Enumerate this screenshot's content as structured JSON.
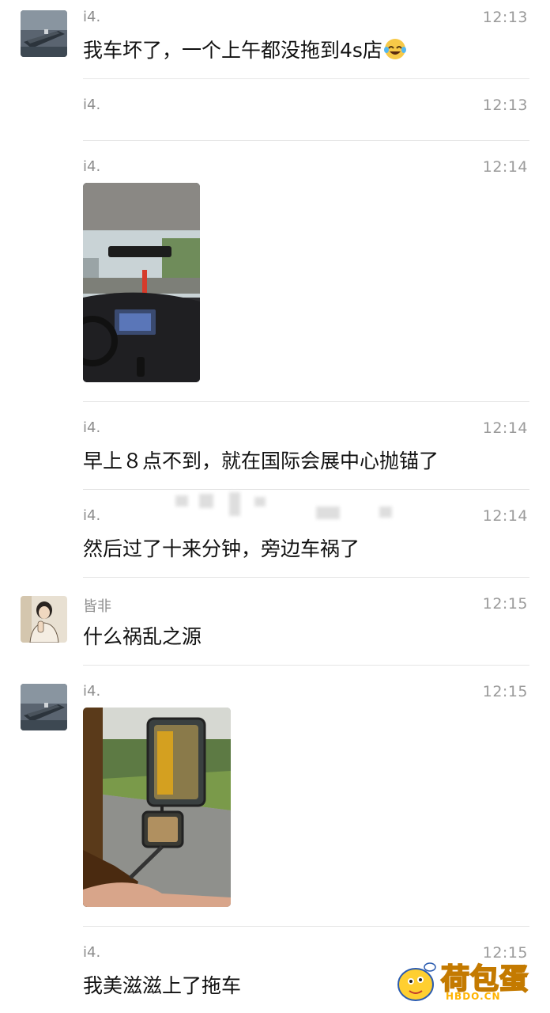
{
  "messages": [
    {
      "name": "i4.",
      "time": "12:13",
      "text": "我车坏了，一个上午都没拖到4s店"
    },
    {
      "name": "i4.",
      "time": "12:13",
      "text": ""
    },
    {
      "name": "i4.",
      "time": "12:14",
      "text": ""
    },
    {
      "name": "i4.",
      "time": "12:14",
      "text": "早上８点不到，就在国际会展中心抛锚了"
    },
    {
      "name": "i4.",
      "time": "12:14",
      "text": "然后过了十来分钟，旁边车祸了"
    },
    {
      "name": "皆非",
      "time": "12:15",
      "text": "什么祸乱之源"
    },
    {
      "name": "i4.",
      "time": "12:15",
      "text": ""
    },
    {
      "name": "i4.",
      "time": "12:15",
      "text": "我美滋滋上了拖车"
    }
  ],
  "watermark": {
    "text": "荷包蛋",
    "subtext": "HBDO.CN"
  },
  "colors": {
    "name": "#8c8c8c",
    "time": "#9a9a9a",
    "text": "#111111",
    "divider": "#e6e6e6",
    "watermark": "#ffb300"
  }
}
